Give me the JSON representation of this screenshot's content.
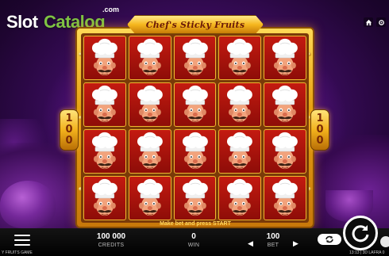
{
  "logo": {
    "part1": "Slot",
    "part2": "Catalog",
    "suffix": ".com"
  },
  "game": {
    "title": "Chef's Sticky Fruits"
  },
  "top_icons": {
    "home": "home-icon",
    "settings": "settings-icon"
  },
  "side_badges": {
    "left_digits": [
      "1",
      "0",
      "0"
    ],
    "right_digits": [
      "1",
      "0",
      "0"
    ]
  },
  "reels": {
    "columns": 5,
    "rows": 4,
    "symbol": "chef-symbol",
    "colors": {
      "cell_bg": "#c41a10",
      "frame_gold": "#f2b11c",
      "hat": "#ffffff"
    }
  },
  "message": "Make bet and press START",
  "bottom_bar": {
    "credits": {
      "value": "100 000",
      "label": "CREDITS"
    },
    "win": {
      "value": "0",
      "label": "WIN"
    },
    "bet": {
      "value": "100",
      "label": "BET"
    },
    "menu_icon": "hamburger-menu-icon",
    "autoplay_icon": "autoplay-icon",
    "spin_icon": "spin-icon"
  },
  "footer": {
    "left": "Y FRUITS GAME",
    "right": "13:13 | 3D LAFRA 0"
  }
}
